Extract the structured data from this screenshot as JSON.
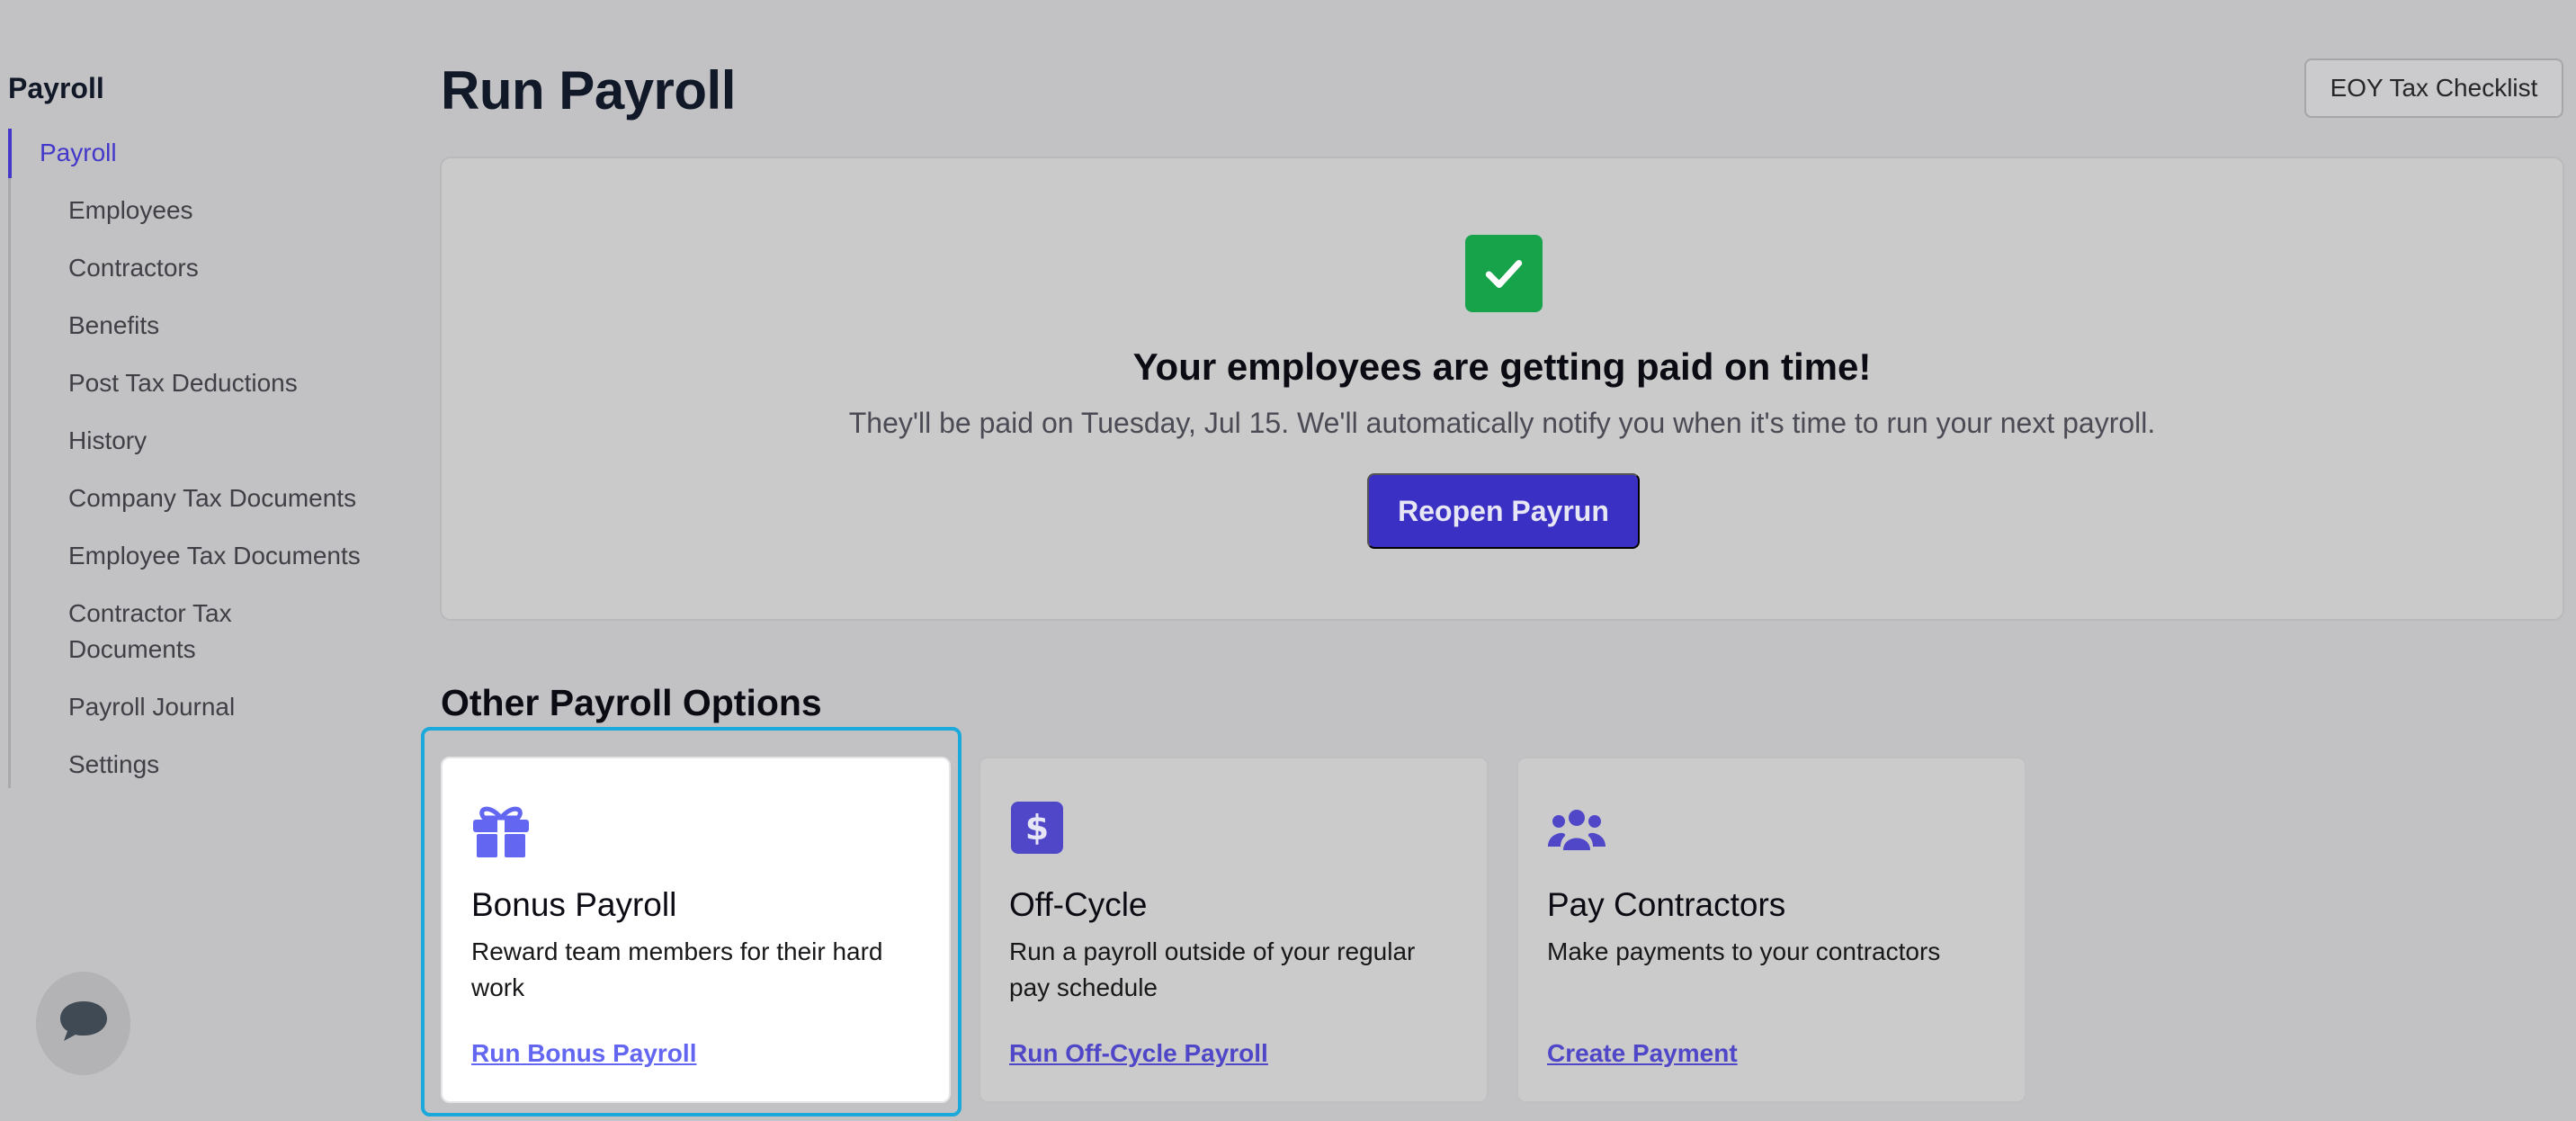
{
  "sidebar": {
    "title": "Payroll",
    "items": [
      {
        "label": "Payroll",
        "active": true
      },
      {
        "label": "Employees"
      },
      {
        "label": "Contractors"
      },
      {
        "label": "Benefits"
      },
      {
        "label": "Post Tax Deductions"
      },
      {
        "label": "History"
      },
      {
        "label": "Company Tax Documents"
      },
      {
        "label": "Employee Tax Documents"
      },
      {
        "label": "Contractor Tax Documents"
      },
      {
        "label": "Payroll Journal"
      },
      {
        "label": "Settings"
      }
    ]
  },
  "header": {
    "title": "Run Payroll",
    "eoy_button": "EOY Tax Checklist"
  },
  "status": {
    "icon": "check-icon",
    "heading": "Your employees are getting paid on time!",
    "subtext": "They'll be paid on Tuesday, Jul 15. We'll automatically notify you when it's time to run your next payroll.",
    "button": "Reopen Payrun"
  },
  "options": {
    "title": "Other Payroll Options",
    "cards": [
      {
        "icon": "gift-icon",
        "title": "Bonus Payroll",
        "desc": "Reward team members for their hard work",
        "link": "Run Bonus Payroll"
      },
      {
        "icon": "dollar-icon",
        "title": "Off-Cycle",
        "desc": "Run a payroll outside of your regular pay schedule",
        "link": "Run Off-Cycle Payroll"
      },
      {
        "icon": "users-icon",
        "title": "Pay Contractors",
        "desc": "Make payments to your contractors",
        "link": "Create Payment"
      }
    ]
  },
  "chat": {
    "icon": "chat-icon"
  },
  "colors": {
    "accent": "#4338ca",
    "success": "#16a34a",
    "focus": "#1ba9dc",
    "link": "#4f46c8"
  }
}
